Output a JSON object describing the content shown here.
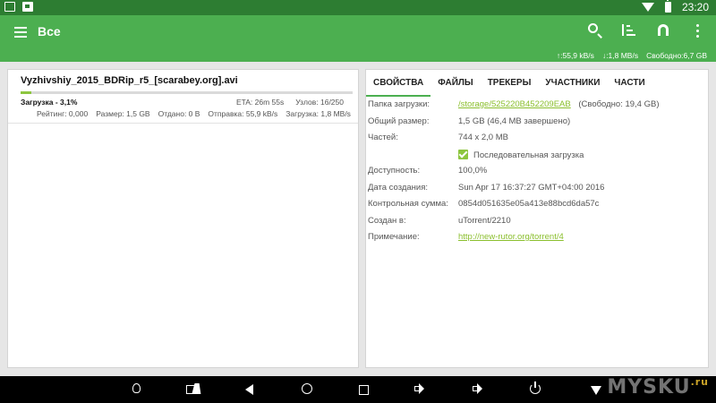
{
  "status_bar": {
    "time": "23:20",
    "icons": [
      "image-icon",
      "app-notification-icon",
      "wifi-icon",
      "battery-icon"
    ]
  },
  "app_bar": {
    "title": "Все",
    "actions": [
      "search-icon",
      "sort-icon",
      "magnet-icon",
      "overflow-menu-icon"
    ],
    "upload_speed": "↑:55,9 kB/s",
    "download_speed": "↓:1,8 MB/s",
    "free_space": "Свободно:6,7 GB"
  },
  "torrent": {
    "name": "Vyzhivshiy_2015_BDRip_r5_[scarabey.org].avi",
    "status": "Загрузка - 3,1%",
    "progress": 0.031,
    "eta": "ETA: 26m 55s",
    "peers": "Узлов: 16/250",
    "rating": "Рейтинг: 0,000",
    "size": "Размер: 1,5 GB",
    "uploaded": "Отдано: 0 B",
    "upload_rate": "Отправка: 55,9 kB/s",
    "download_rate": "Загрузка: 1,8 MB/s"
  },
  "tabs": [
    "СВОЙСТВА",
    "ФАЙЛЫ",
    "ТРЕКЕРЫ",
    "УЧАСТНИКИ",
    "ЧАСТИ"
  ],
  "properties": {
    "folder_label": "Папка загрузки:",
    "folder_link": "/storage/525220B452209EAB",
    "folder_free": "(Свободно: 19,4 GB)",
    "total_size_label": "Общий размер:",
    "total_size": "1,5 GB (46,4 MB завершено)",
    "pieces_label": "Частей:",
    "pieces": "744 x 2,0 MB",
    "sequential_label": "Последовательная загрузка",
    "sequential_checked": true,
    "availability_label": "Доступность:",
    "availability": "100,0%",
    "created_label": "Дата создания:",
    "created": "Sun Apr 17 16:37:27 GMT+04:00 2016",
    "hash_label": "Контрольная сумма:",
    "hash": "0854d051635e05a413e88bcd6da57c",
    "created_by_label": "Создан в:",
    "created_by": "uTorrent/2210",
    "comment_label": "Примечание:",
    "comment": "http://new-rutor.org/torrent/4"
  },
  "watermark": {
    "text": "MYSKU",
    "suffix": ".ru"
  }
}
